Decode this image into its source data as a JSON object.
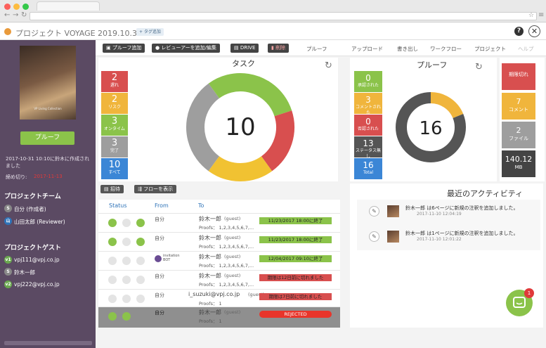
{
  "window": {
    "title": "プロジェクト VOYAGE 2019.10.31",
    "tag_button": "+ タグ追加",
    "help": "?",
    "close": "✕"
  },
  "sidebar": {
    "cover_caption": "VP Living Collection",
    "proof_button": "プルーフ",
    "created": "2017-10-31 10:10に鈴木に作成されました",
    "deadline_label": "締め切り:",
    "deadline_value": "2017-11-13",
    "team_title": "プロジェクトチーム",
    "team": [
      {
        "initial": "S",
        "name": "自分 (作成者)",
        "color": "#888888"
      },
      {
        "initial": "山",
        "name": "山田太郎 (Reviewer)",
        "color": "#2e73b8"
      }
    ],
    "guest_title": "プロジェクトゲスト",
    "guests": [
      {
        "initial": "v1",
        "name": "vpj111@vpj.co.jp",
        "color": "#6aa84f"
      },
      {
        "initial": "S",
        "name": "鈴木一郎",
        "color": "#888888"
      },
      {
        "initial": "v2",
        "name": "vpj222@vpj.co.jp",
        "color": "#6aa84f"
      }
    ]
  },
  "toolbar": {
    "buttons": [
      "プルーフ追加",
      "レビューアーを追加/編集",
      "DRIVE",
      "削除"
    ],
    "links": [
      "プルーフ",
      "アップロード",
      "書き出し",
      "ワークフロー",
      "プロジェクト",
      "ヘルプ"
    ]
  },
  "tasks": {
    "title": "タスク",
    "total": "10",
    "bars": [
      {
        "value": "2",
        "label": "遅れ",
        "color": "#d84f4f"
      },
      {
        "value": "2",
        "label": "リスク",
        "color": "#f0b53c"
      },
      {
        "value": "3",
        "label": "オンタイム",
        "color": "#8bc34a"
      },
      {
        "value": "3",
        "label": "完了",
        "color": "#9e9e9e"
      },
      {
        "value": "10",
        "label": "すべて",
        "color": "#3b86d6"
      }
    ],
    "donut": [
      {
        "value": 3,
        "color": "#8bc34a"
      },
      {
        "value": 2,
        "color": "#d84f4f"
      },
      {
        "value": 2,
        "color": "#f1c232"
      },
      {
        "value": 3,
        "color": "#9e9e9e"
      }
    ]
  },
  "proofs": {
    "title": "プルーフ",
    "total": "16",
    "bars": [
      {
        "value": "0",
        "label": "承認された",
        "color": "#8bc34a"
      },
      {
        "value": "3",
        "label": "コメントされた",
        "color": "#f0b53c"
      },
      {
        "value": "0",
        "label": "否認された",
        "color": "#d84f4f"
      },
      {
        "value": "13",
        "label": "ステータス無し",
        "color": "#555555"
      },
      {
        "value": "16",
        "label": "Total",
        "color": "#3b86d6"
      }
    ],
    "donut": [
      {
        "value": 3,
        "color": "#f0b53c"
      },
      {
        "value": 13,
        "color": "#555555"
      }
    ],
    "tiles": [
      {
        "value": "",
        "label": "期限切れ",
        "color": "#d84f4f"
      },
      {
        "value": "7",
        "label": "コメント",
        "color": "#f0b53c"
      },
      {
        "value": "2",
        "label": "ファイル",
        "color": "#9e9e9e"
      },
      {
        "value": "140.12",
        "label": "MB",
        "color": "#444444"
      }
    ]
  },
  "actions": {
    "invite": "招待",
    "show_flow": "フローを表示"
  },
  "table": {
    "headers": [
      "Status",
      "From",
      "To"
    ],
    "rows": [
      {
        "from": "自分",
        "to": "鈴木一郎",
        "guest": "(guest)",
        "proofs": "Proofs： 1,2,3,4,5,6,7,...",
        "status": "11/23/2017 18:00に終了",
        "status_color": "#8bc34a"
      },
      {
        "from": "自分",
        "to": "鈴木一郎",
        "guest": "(guest)",
        "proofs": "Proofs： 1,2,3,4,5,6,7,...",
        "status": "11/23/2017 18:00に終了",
        "status_color": "#8bc34a"
      },
      {
        "from": "invitation BOT",
        "to": "鈴木一郎",
        "guest": "(guest)",
        "proofs": "Proofs： 1,2,3,4,5,6,7,...",
        "status": "12/04/2017 09:10に終了",
        "status_color": "#8bc34a"
      },
      {
        "from": "自分",
        "to": "鈴木一郎",
        "guest": "(guest)",
        "proofs": "Proofs： 1,2,3,4,5,6,7,...",
        "status": "期限は12日前に切れました",
        "status_color": "#d84f4f"
      },
      {
        "from": "自分",
        "to": "i_suzuki@vpj.co.jp",
        "guest": "(guest)",
        "proofs": "Proofs： 1",
        "status": "期限は7日前に切れました",
        "status_color": "#d84f4f"
      },
      {
        "from": "自分",
        "to": "鈴木一郎",
        "guest": "(guest)",
        "proofs": "Proofs： 1",
        "status": "REJECTED",
        "status_color": "#e8352b"
      }
    ]
  },
  "activity": {
    "title": "最近のアクティビティ",
    "items": [
      {
        "text": "鈴木一郎 は6ページに新規の注釈を追加しました。",
        "time": "2017-11-10 12:04:19"
      },
      {
        "text": "鈴木一郎 は1ページに新規の注釈を追加しました。",
        "time": "2017-11-10 12:01:22"
      }
    ]
  },
  "chat": {
    "badge": "1"
  }
}
